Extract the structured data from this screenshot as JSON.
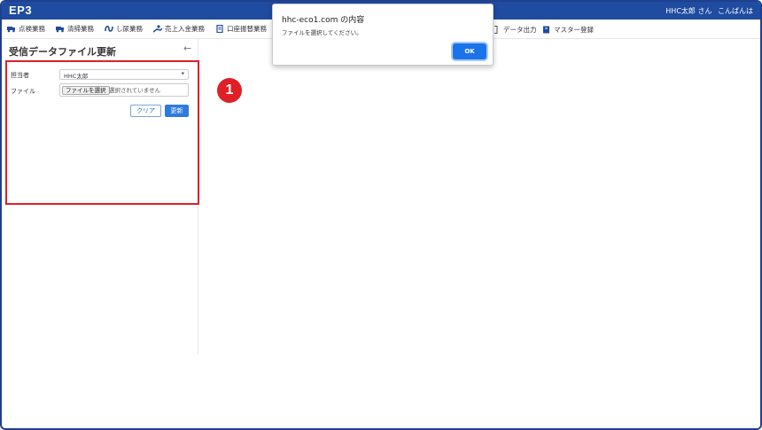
{
  "app": {
    "title": "EP3"
  },
  "user": {
    "name": "HHC太郎 さん",
    "greeting": "こんばんは"
  },
  "menu": {
    "items": [
      {
        "label": "点検業務",
        "icon": "truck-icon"
      },
      {
        "label": "清掃業務",
        "icon": "truck-icon"
      },
      {
        "label": "し尿業務",
        "icon": "loop-icon"
      },
      {
        "label": "売上入金業務",
        "icon": "money-hand-icon"
      },
      {
        "label": "口座振替業務",
        "icon": "document-icon"
      }
    ],
    "right_items": [
      {
        "label": "データ出力",
        "icon": "bracket-icon"
      },
      {
        "label": "マスター登録",
        "icon": "book-icon"
      }
    ]
  },
  "sidebar": {
    "title": "受信データファイル更新",
    "back_icon": "arrow-left-icon",
    "fields": {
      "person_label": "担当者",
      "person_value": "HHC太郎",
      "file_label": "ファイル",
      "file_button": "ファイルを選択",
      "file_status": "選択されていません"
    },
    "buttons": {
      "clear": "クリア",
      "update": "更新"
    }
  },
  "badge": {
    "number": "1"
  },
  "dialog": {
    "title": "hhc-eco1.com の内容",
    "message": "ファイルを選択してください。",
    "ok_label": "OK"
  },
  "colors": {
    "topbar": "#1f4ba0",
    "highlight": "#e01f26",
    "primary_button": "#2f7bdd",
    "dialog_ok": "#1a73e8"
  }
}
